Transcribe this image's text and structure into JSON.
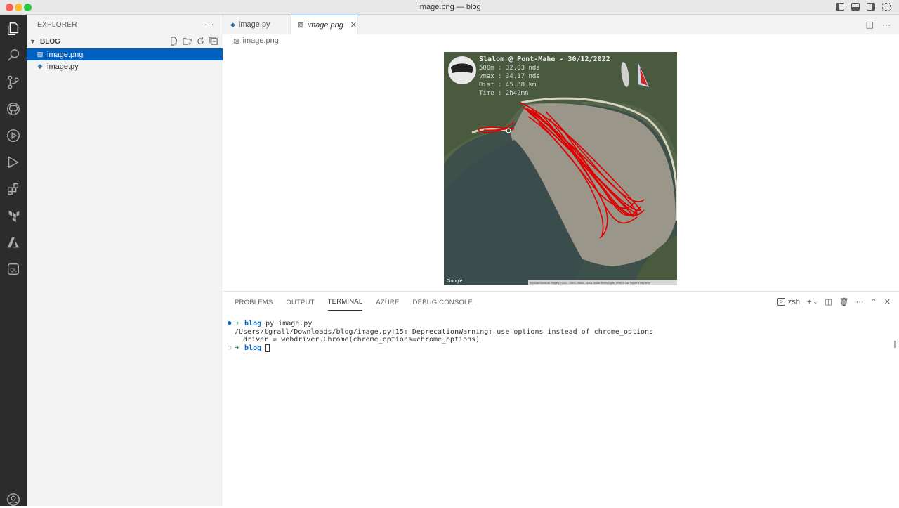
{
  "window": {
    "title": "image.png — blog"
  },
  "sidebar": {
    "header": "EXPLORER",
    "more": "···",
    "folder": "BLOG",
    "files": [
      {
        "name": "image.png",
        "icon": "image-file-icon",
        "selected": true
      },
      {
        "name": "image.py",
        "icon": "python-file-icon",
        "selected": false
      }
    ]
  },
  "editor": {
    "tabs": [
      {
        "label": "image.py",
        "active": false
      },
      {
        "label": "image.png",
        "active": true,
        "close": "✕"
      }
    ],
    "breadcrumb": "image.png"
  },
  "image": {
    "title": "Slalom @ Pont-Mahé - 30/12/2022",
    "stats": [
      "500m : 32.03 nds",
      "vmax : 34.17 nds",
      "Dist : 45.88 km",
      "Time : 2h42mn"
    ],
    "watermark": "Google",
    "attribution": "Keyboard shortcuts   Imagery ©2023 , CNES / Airbus, Airbus, Maxar Technologies   Terms of Use   Report a map error"
  },
  "panel": {
    "tabs": [
      "PROBLEMS",
      "OUTPUT",
      "TERMINAL",
      "AZURE",
      "DEBUG CONSOLE"
    ],
    "active_tab": "TERMINAL",
    "shell": "zsh",
    "terminal": {
      "prompt_symbol": "➜",
      "dir": "blog",
      "command": "py image.py",
      "output": [
        "/Users/tgrall/Downloads/blog/image.py:15: DeprecationWarning: use options instead of chrome_options",
        "  driver = webdriver.Chrome(chrome_options=chrome_options)"
      ]
    }
  },
  "colors": {
    "accent": "#0060c0",
    "track": "#e00000",
    "activitybar": "#2c2c2c"
  }
}
